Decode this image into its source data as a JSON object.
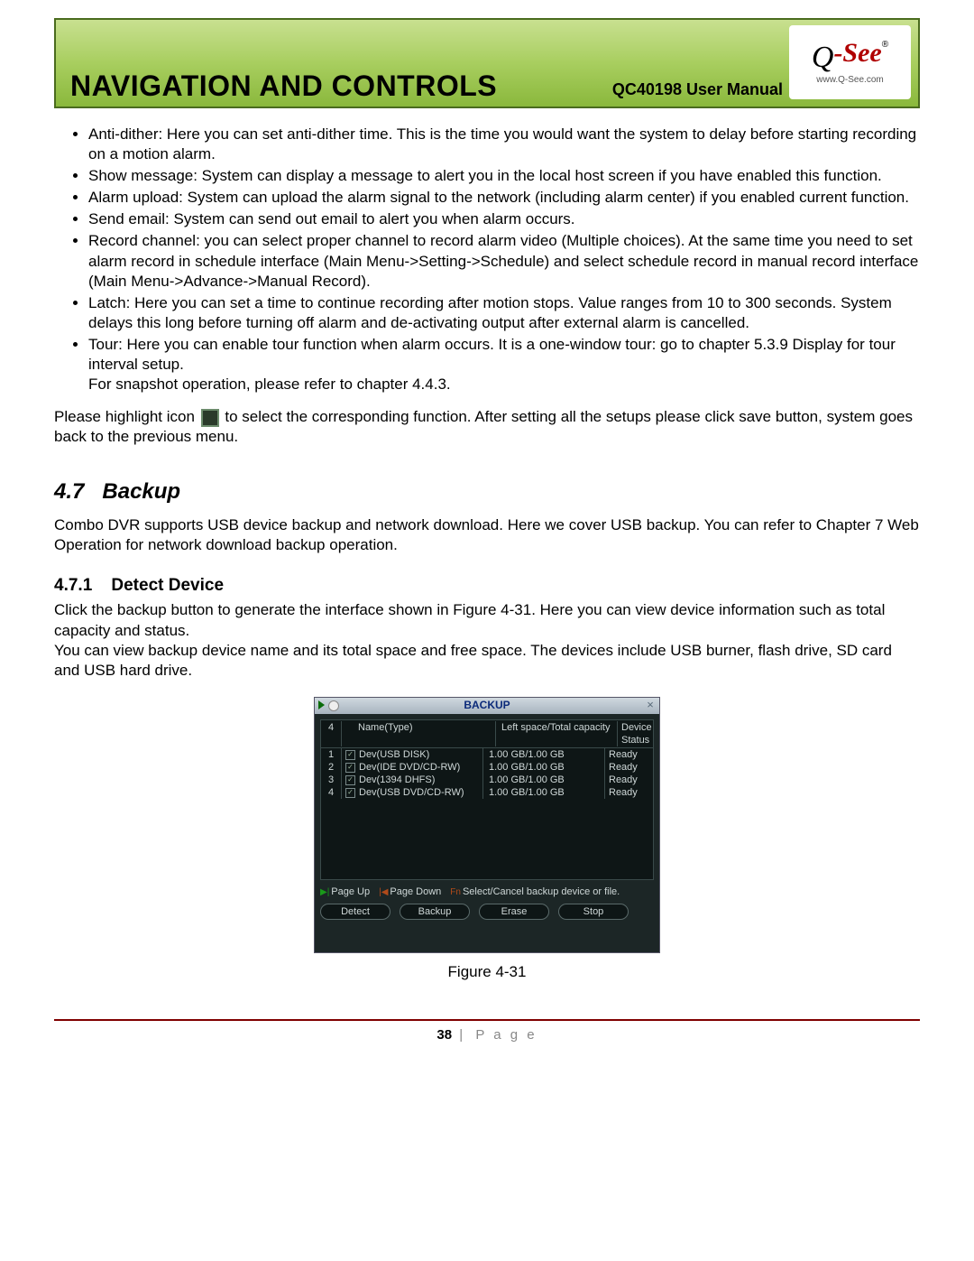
{
  "header": {
    "title": "NAVIGATION AND CONTROLS",
    "subtitle": "QC40198 User Manual",
    "logo_text": "-See",
    "logo_url": "www.Q-See.com"
  },
  "bullets": [
    "Anti-dither: Here you can set anti-dither time. This is the time you would want the system to delay before starting recording on a motion alarm.",
    "Show message: System can display a message to alert you in the local host screen if you have enabled this function.",
    "Alarm upload: System can upload the alarm signal to the network (including alarm center) if you enabled current function.",
    "Send email: System can send out email to alert you when alarm occurs.",
    "Record channel: you can select proper channel to record alarm video (Multiple choices). At the same time you need to set alarm record in schedule interface (Main Menu->Setting->Schedule) and select schedule record in manual record interface (Main Menu->Advance->Manual Record).",
    "Latch: Here you can set a time to continue recording after motion stops. Value ranges from 10 to 300 seconds. System delays this long before turning off alarm and de-activating output after external alarm is cancelled.",
    "Tour: Here you can enable tour function when alarm occurs.  It is a one-window tour: go to chapter 5.3.9 Display for tour interval setup."
  ],
  "snapshot_line": "For snapshot operation, please refer to chapter 4.4.3.",
  "highlight_before": "Please highlight icon ",
  "highlight_after": " to select the corresponding function. After setting all the setups please click save button, system goes back to the previous menu.",
  "section": {
    "num": "4.7",
    "title": "Backup",
    "intro": "Combo DVR supports USB device backup and network download. Here we cover USB backup. You can refer to Chapter 7 Web Operation for network download backup operation."
  },
  "subsection": {
    "num": "4.7.1",
    "title": "Detect Device",
    "p1": "Click the backup button to generate the interface shown in Figure 4-31. Here you can view device information such as total capacity and status.",
    "p2": "You can view backup device name and its total space and free space. The devices include USB burner, flash drive, SD card and USB hard drive."
  },
  "dialog": {
    "title": "BACKUP",
    "count": "4",
    "columns": {
      "name": "Name(Type)",
      "cap": "Left space/Total capacity",
      "stat": "Device Status"
    },
    "rows": [
      {
        "idx": "1",
        "name": "Dev(USB DISK)",
        "cap": "1.00 GB/1.00 GB",
        "stat": "Ready"
      },
      {
        "idx": "2",
        "name": "Dev(IDE DVD/CD-RW)",
        "cap": "1.00 GB/1.00 GB",
        "stat": "Ready"
      },
      {
        "idx": "3",
        "name": "Dev(1394 DHFS)",
        "cap": "1.00 GB/1.00 GB",
        "stat": "Ready"
      },
      {
        "idx": "4",
        "name": "Dev(USB DVD/CD-RW)",
        "cap": "1.00 GB/1.00 GB",
        "stat": "Ready"
      }
    ],
    "hints": {
      "pageup": "Page Up",
      "pagedown": "Page Down",
      "select": "Select/Cancel backup device or file."
    },
    "buttons": {
      "detect": "Detect",
      "backup": "Backup",
      "erase": "Erase",
      "stop": "Stop"
    }
  },
  "figure_caption": "Figure 4-31",
  "footer": {
    "num": "38",
    "label": "P a g e"
  }
}
